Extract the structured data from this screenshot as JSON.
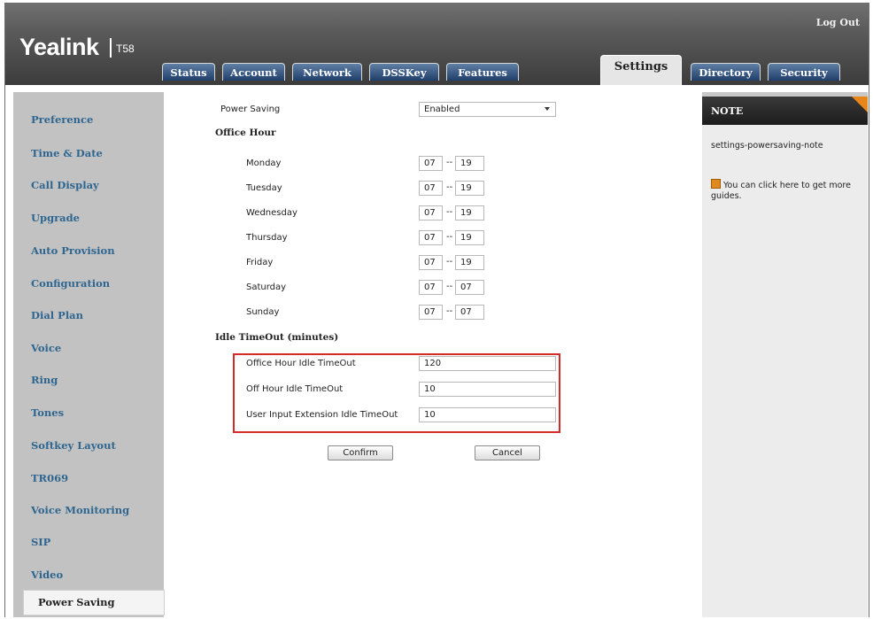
{
  "app": {
    "logo": "Yealink",
    "model": "T58",
    "logout": "Log Out"
  },
  "tabs": [
    {
      "label": "Status",
      "active": false
    },
    {
      "label": "Account",
      "active": false
    },
    {
      "label": "Network",
      "active": false
    },
    {
      "label": "DSSKey",
      "active": false
    },
    {
      "label": "Features",
      "active": false
    },
    {
      "label": "Settings",
      "active": true
    },
    {
      "label": "Directory",
      "active": false
    },
    {
      "label": "Security",
      "active": false
    }
  ],
  "sidebar": {
    "items": [
      "Preference",
      "Time & Date",
      "Call Display",
      "Upgrade",
      "Auto Provision",
      "Configuration",
      "Dial Plan",
      "Voice",
      "Ring",
      "Tones",
      "Softkey Layout",
      "TR069",
      "Voice Monitoring",
      "SIP",
      "Video"
    ],
    "active": "Power Saving"
  },
  "form": {
    "power_saving_label": "Power Saving",
    "power_saving_value": "Enabled",
    "office_hour_heading": "Office Hour",
    "days": [
      {
        "label": "Monday",
        "start": "07",
        "end": "19"
      },
      {
        "label": "Tuesday",
        "start": "07",
        "end": "19"
      },
      {
        "label": "Wednesday",
        "start": "07",
        "end": "19"
      },
      {
        "label": "Thursday",
        "start": "07",
        "end": "19"
      },
      {
        "label": "Friday",
        "start": "07",
        "end": "19"
      },
      {
        "label": "Saturday",
        "start": "07",
        "end": "07"
      },
      {
        "label": "Sunday",
        "start": "07",
        "end": "07"
      }
    ],
    "dash": "--",
    "idle_heading": "Idle TimeOut (minutes)",
    "idle": [
      {
        "label": "Office Hour Idle TimeOut",
        "value": "120"
      },
      {
        "label": "Off Hour Idle TimeOut",
        "value": "10"
      },
      {
        "label": "User Input Extension Idle TimeOut",
        "value": "10"
      }
    ],
    "confirm": "Confirm",
    "cancel": "Cancel"
  },
  "note": {
    "title": "NOTE",
    "text": "settings-powersaving-note",
    "guide": "You can click here to get more guides."
  },
  "colors": {
    "nav_link": "#2f6690",
    "highlight": "#d42a2a",
    "note_corner": "#e8861a"
  }
}
